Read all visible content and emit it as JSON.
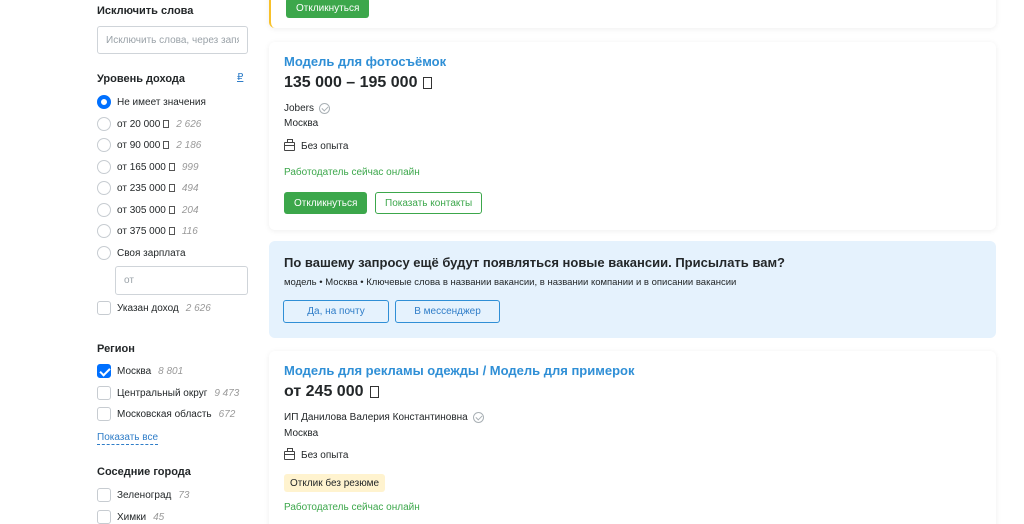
{
  "filters": {
    "exclude": {
      "title": "Исключить слова",
      "placeholder": "Исключить слова, через запятую"
    },
    "income": {
      "title": "Уровень дохода",
      "currency_link": "₽",
      "options": [
        {
          "label": "Не имеет значения",
          "count": ""
        },
        {
          "label": "от 20 000",
          "count": "2 626"
        },
        {
          "label": "от 90 000",
          "count": "2 186"
        },
        {
          "label": "от 165 000",
          "count": "999"
        },
        {
          "label": "от 235 000",
          "count": "494"
        },
        {
          "label": "от 305 000",
          "count": "204"
        },
        {
          "label": "от 375 000",
          "count": "116"
        },
        {
          "label": "Своя зарплата",
          "count": ""
        }
      ],
      "own_placeholder": "от",
      "specified": {
        "label": "Указан доход",
        "count": "2 626"
      }
    },
    "region": {
      "title": "Регион",
      "items": [
        {
          "label": "Москва",
          "count": "8 801",
          "checked": true
        },
        {
          "label": "Центральный округ",
          "count": "9 473",
          "checked": false
        },
        {
          "label": "Московская область",
          "count": "672",
          "checked": false
        }
      ],
      "show_all": "Показать все"
    },
    "neighbors": {
      "title": "Соседние города",
      "items": [
        {
          "label": "Зеленоград",
          "count": "73"
        },
        {
          "label": "Химки",
          "count": "45"
        }
      ]
    }
  },
  "top_card": {
    "respond_label": "Откликнуться"
  },
  "vacancy1": {
    "title": "Модель для фотосъёмок",
    "salary": "135 000 – 195 000",
    "company": "Jobers",
    "city": "Москва",
    "experience": "Без опыта",
    "online": "Работодатель сейчас онлайн",
    "respond_label": "Откликнуться",
    "contacts_label": "Показать контакты"
  },
  "subscribe": {
    "title": "По вашему запросу ещё будут появляться новые вакансии. Присылать вам?",
    "text": "модель • Москва • Ключевые слова в названии вакансии, в названии компании и в описании вакансии",
    "email_label": "Да, на почту",
    "messenger_label": "В мессенджер",
    "bg_color": "#e5f2fd"
  },
  "vacancy2": {
    "title": "Модель для рекламы одежды / Модель для примерок",
    "salary": "от 245 000",
    "company": "ИП Данилова Валерия Константиновна",
    "city": "Москва",
    "experience": "Без опыта",
    "badge": "Отклик без резюме",
    "online": "Работодатель сейчас онлайн"
  },
  "colors": {
    "accent_blue": "#0070ff",
    "link_blue": "#2f8fd6",
    "green": "#3ca74b",
    "highlight_yellow": "#f8c12a"
  }
}
